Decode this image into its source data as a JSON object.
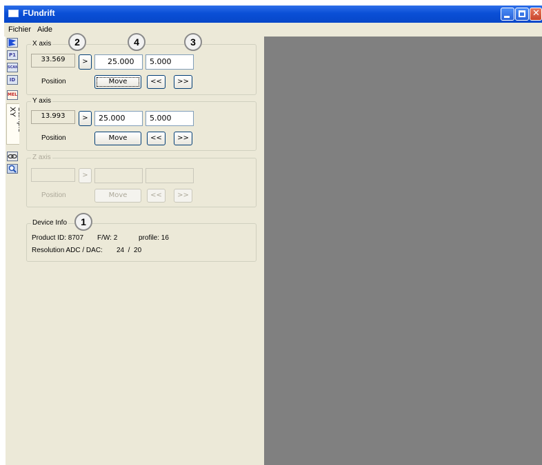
{
  "window": {
    "title": "FUndrift"
  },
  "menu": {
    "items": [
      "Fichier",
      "Aide"
    ]
  },
  "toolstrip": {
    "icons": [
      "flag-icon",
      "p1-icon",
      "scan-icon",
      "id-icon",
      "mel-icon"
    ],
    "icon_labels": [
      "",
      "P1",
      "SCAN",
      "ID",
      "MEL"
    ],
    "active_tab": "Sample XY"
  },
  "x_axis": {
    "legend": "X axis",
    "readout": "33.569",
    "go_label": ">",
    "target": "25.000",
    "step": "5.000",
    "position_label": "Position",
    "move_label": "Move",
    "prev_label": "<<",
    "next_label": ">>"
  },
  "y_axis": {
    "legend": "Y axis",
    "readout": "13.993",
    "go_label": ">",
    "target": "25.000",
    "step": "5.000",
    "position_label": "Position",
    "move_label": "Move",
    "prev_label": "<<",
    "next_label": ">>"
  },
  "z_axis": {
    "legend": "Z axis",
    "readout": "",
    "go_label": ">",
    "target": "",
    "step": "",
    "position_label": "Position",
    "move_label": "Move",
    "prev_label": "<<",
    "next_label": ">>"
  },
  "device_info": {
    "legend": "Device Info",
    "product_id_line": "Product ID: 8707",
    "fw_line": "F/W: 2",
    "profile_line": "profile: 16",
    "resolution_line": "Resolution ADC / DAC:",
    "resolution_values": "24  /  20"
  },
  "callouts": {
    "c1": "1",
    "c2": "2",
    "c3": "3",
    "c4": "4"
  },
  "colors": {
    "titlebar": "#0a4fd6",
    "panel": "#ece9d8",
    "workspace": "#808080"
  }
}
